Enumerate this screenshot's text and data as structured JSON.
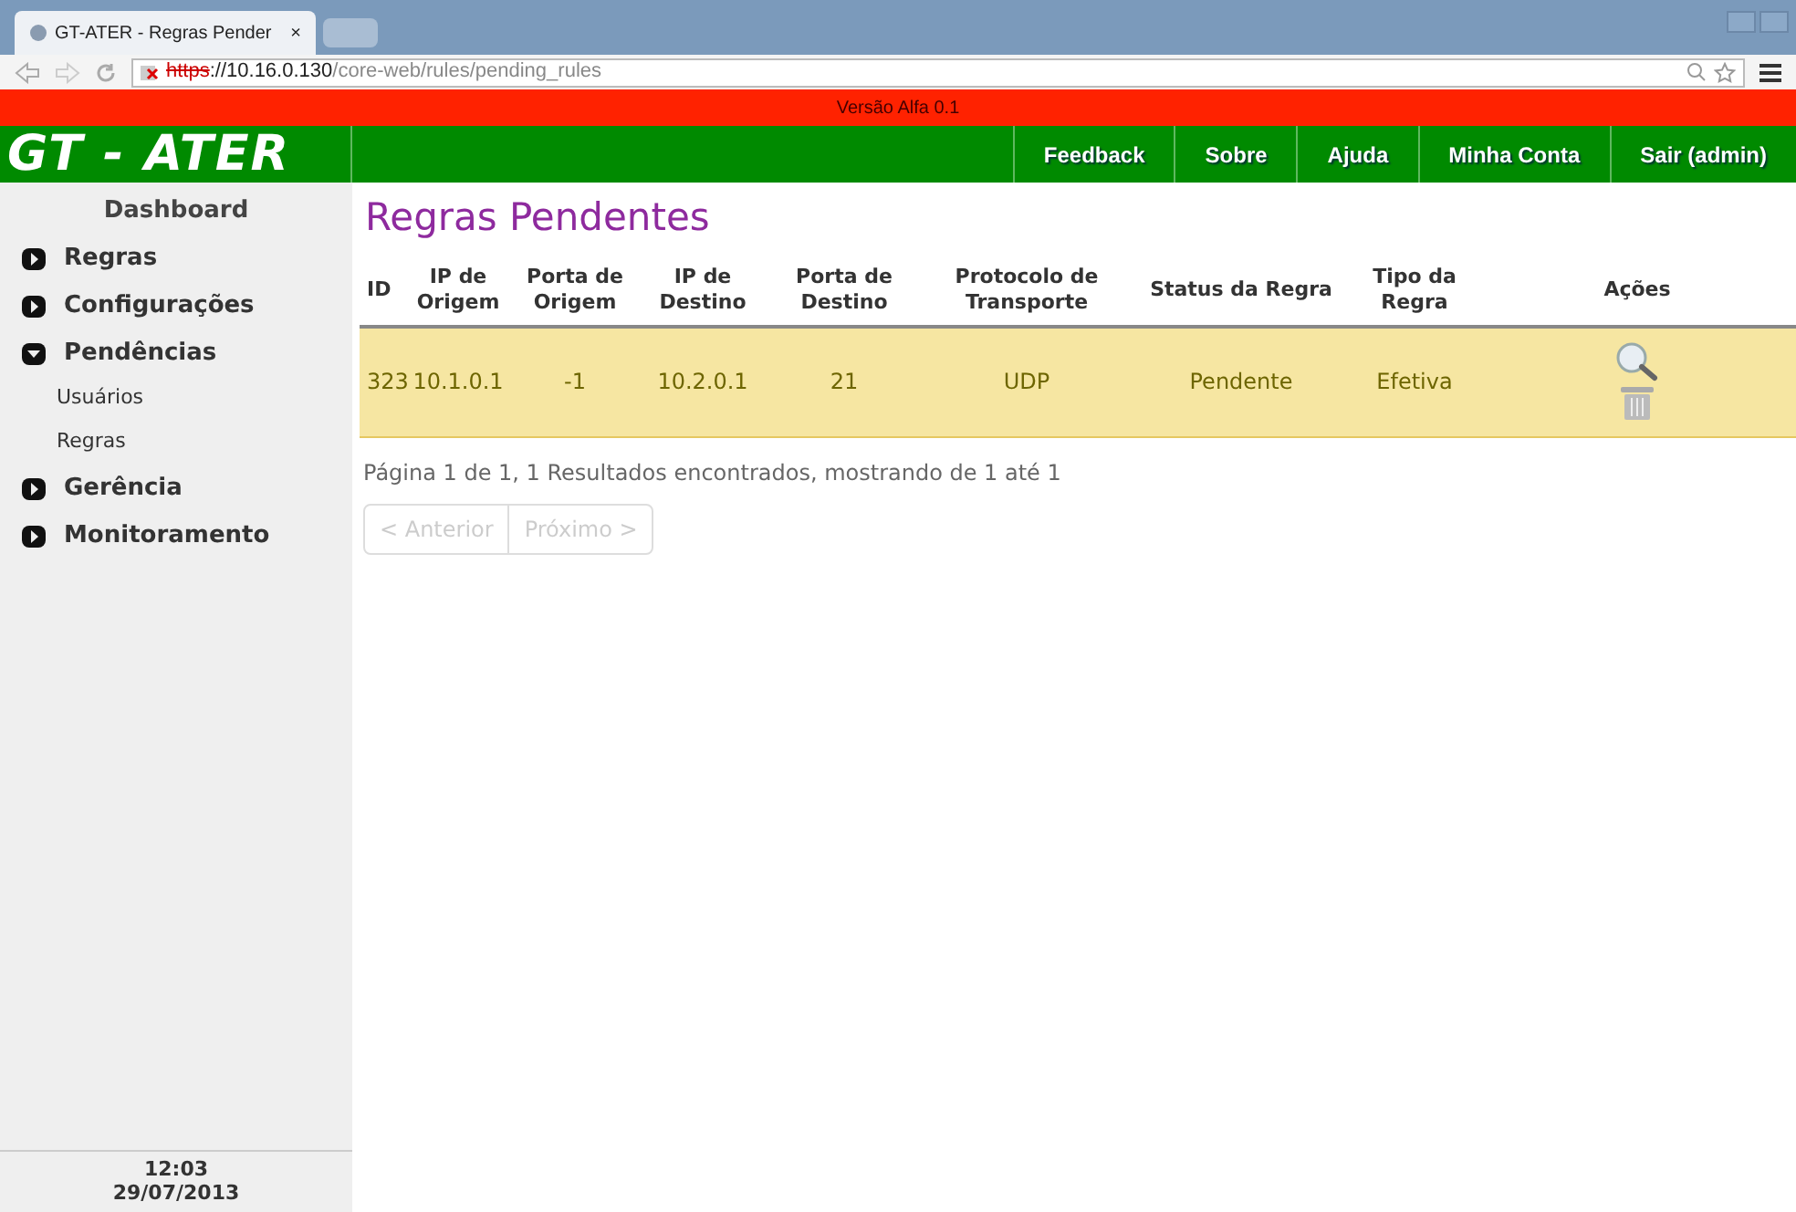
{
  "browser": {
    "tab_title": "GT-ATER - Regras Pender",
    "tab_close": "×",
    "url_scheme": "https",
    "url_host": "://10.16.0.130",
    "url_path": "/core-web/rules/pending_rules"
  },
  "version_banner": "Versão Alfa 0.1",
  "header": {
    "logo": "GT - ATER",
    "nav": [
      "Feedback",
      "Sobre",
      "Ajuda",
      "Minha Conta",
      "Sair (admin)"
    ]
  },
  "sidebar": {
    "title": "Dashboard",
    "items": [
      {
        "label": "Regras",
        "expanded": false
      },
      {
        "label": "Configurações",
        "expanded": false
      },
      {
        "label": "Pendências",
        "expanded": true,
        "children": [
          {
            "label": "Usuários"
          },
          {
            "label": "Regras"
          }
        ]
      },
      {
        "label": "Gerência",
        "expanded": false
      },
      {
        "label": "Monitoramento",
        "expanded": false
      }
    ],
    "time": "12:03",
    "date": "29/07/2013"
  },
  "page_title": "Regras Pendentes",
  "table": {
    "columns": [
      "ID",
      "IP de Origem",
      "Porta de Origem",
      "IP de Destino",
      "Porta de Destino",
      "Protocolo de Transporte",
      "Status da Regra",
      "Tipo da Regra",
      "Ações"
    ],
    "rows": [
      {
        "cells": [
          "323",
          "10.1.0.1",
          "-1",
          "10.2.0.1",
          "21",
          "UDP",
          "Pendente",
          "Efetiva"
        ],
        "selected": true
      }
    ]
  },
  "pagination": {
    "summary": "Página 1 de 1, 1 Resultados encontrados, mostrando de 1 até 1",
    "prev": {
      "label": "< Anterior",
      "disabled": true
    },
    "next": {
      "label": "Próximo >",
      "disabled": true
    }
  }
}
